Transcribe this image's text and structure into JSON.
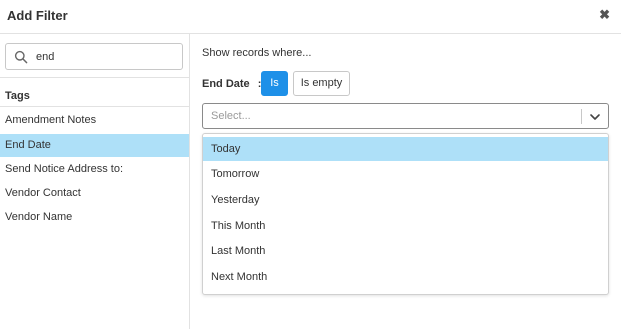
{
  "header": {
    "title": "Add Filter",
    "close_glyph": "✖"
  },
  "sidebar": {
    "search": {
      "value": "end",
      "icon": "search-icon"
    },
    "tags_title": "Tags",
    "items": [
      {
        "label": "Amendment Notes",
        "active": false
      },
      {
        "label": "End Date",
        "active": true
      },
      {
        "label": "Send Notice Address to:",
        "active": false
      },
      {
        "label": "Vendor Contact",
        "active": false
      },
      {
        "label": "Vendor Name",
        "active": false
      }
    ]
  },
  "main": {
    "show_records_label": "Show records where...",
    "field_label": "End Date",
    "field_separator": ":",
    "operators": [
      {
        "label": "Is",
        "selected": true
      },
      {
        "label": "Is empty",
        "selected": false
      }
    ],
    "select": {
      "placeholder": "Select...",
      "icon": "chevron-down-icon"
    },
    "options": [
      {
        "label": "Today",
        "highlighted": true
      },
      {
        "label": "Tomorrow",
        "highlighted": false
      },
      {
        "label": "Yesterday",
        "highlighted": false
      },
      {
        "label": "This Month",
        "highlighted": false
      },
      {
        "label": "Last Month",
        "highlighted": false
      },
      {
        "label": "Next Month",
        "highlighted": false
      }
    ]
  },
  "colors": {
    "accent": "#1e90e8",
    "highlight": "#aee0f8",
    "border": "#e2e2e2",
    "text": "#333333",
    "placeholder": "#9a9a9a"
  }
}
